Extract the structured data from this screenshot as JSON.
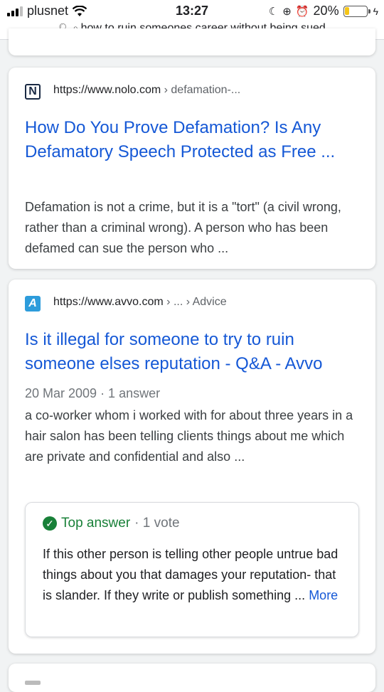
{
  "status": {
    "carrier": "plusnet",
    "time": "13:27",
    "battery": "20%",
    "battery_level": 0.2
  },
  "urlbar": {
    "query": "how to ruin someones career without being sued"
  },
  "results": [
    {
      "favicon_letter": "N",
      "site": "https://www.nolo.com",
      "crumb": " › defamation-...",
      "title": "How Do You Prove Defamation? Is Any Defamatory Speech Protected as Free ...",
      "snippet": "Defamation is not a crime, but it is a \"tort\" (a civil wrong, rather than a criminal wrong). A person who has been defamed can sue the person who  ..."
    },
    {
      "favicon_letter": "A",
      "site": "https://www.avvo.com",
      "crumb": " › ... › Advice",
      "title": "Is it illegal for someone to try to ruin someone elses reputation - Q&A - Avvo",
      "meta": "20 Mar 2009 · 1 answer",
      "snippet": "a co-worker whom i worked with for about three years in a hair salon has been telling clients things about me which are private and confidential and also ...",
      "answer": {
        "label": "Top answer",
        "votes": " · 1 vote",
        "text": "If this other person is telling other people untrue bad things about you that damages your reputation- that is slander. If they write or publish something ... ",
        "more": "More"
      }
    }
  ],
  "colors": {
    "link": "#1558d6",
    "green": "#188038",
    "battery": "#f5c518"
  }
}
